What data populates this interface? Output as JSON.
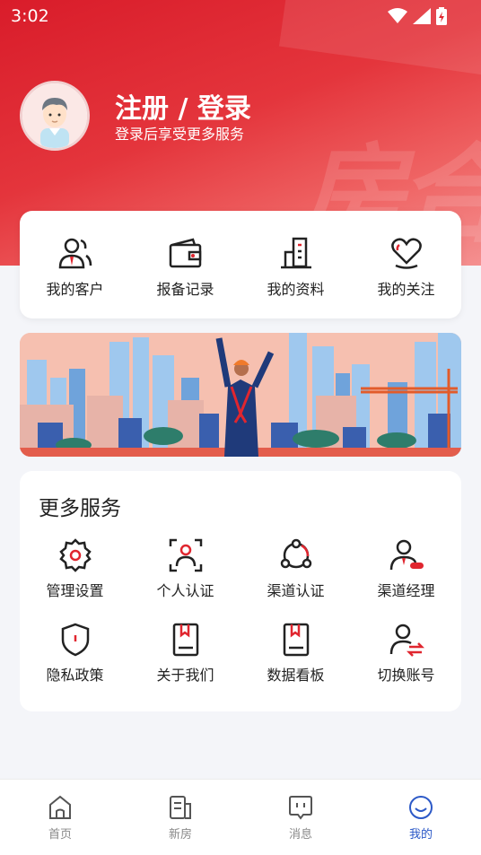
{
  "status_bar": {
    "time": "3:02"
  },
  "header": {
    "title": "注册 / 登录",
    "subtitle": "登录后享受更多服务",
    "watermark": "房合"
  },
  "quick_actions": [
    {
      "label": "我的客户",
      "icon": "customers-icon"
    },
    {
      "label": "报备记录",
      "icon": "wallet-icon"
    },
    {
      "label": "我的资料",
      "icon": "building-icon"
    },
    {
      "label": "我的关注",
      "icon": "heart-icon"
    }
  ],
  "services": {
    "title": "更多服务",
    "items": [
      {
        "label": "管理设置",
        "icon": "settings-gear-icon"
      },
      {
        "label": "个人认证",
        "icon": "face-scan-icon"
      },
      {
        "label": "渠道认证",
        "icon": "channel-nodes-icon"
      },
      {
        "label": "渠道经理",
        "icon": "manager-icon"
      },
      {
        "label": "隐私政策",
        "icon": "shield-icon"
      },
      {
        "label": "关于我们",
        "icon": "book-icon"
      },
      {
        "label": "数据看板",
        "icon": "dashboard-book-icon"
      },
      {
        "label": "切换账号",
        "icon": "switch-account-icon"
      }
    ]
  },
  "bottom_nav": [
    {
      "label": "首页",
      "icon": "home-icon",
      "active": false
    },
    {
      "label": "新房",
      "icon": "new-house-icon",
      "active": false
    },
    {
      "label": "消息",
      "icon": "message-icon",
      "active": false
    },
    {
      "label": "我的",
      "icon": "profile-icon",
      "active": true
    }
  ],
  "colors": {
    "brand_red": "#e0262f",
    "active_blue": "#2c59c7"
  }
}
